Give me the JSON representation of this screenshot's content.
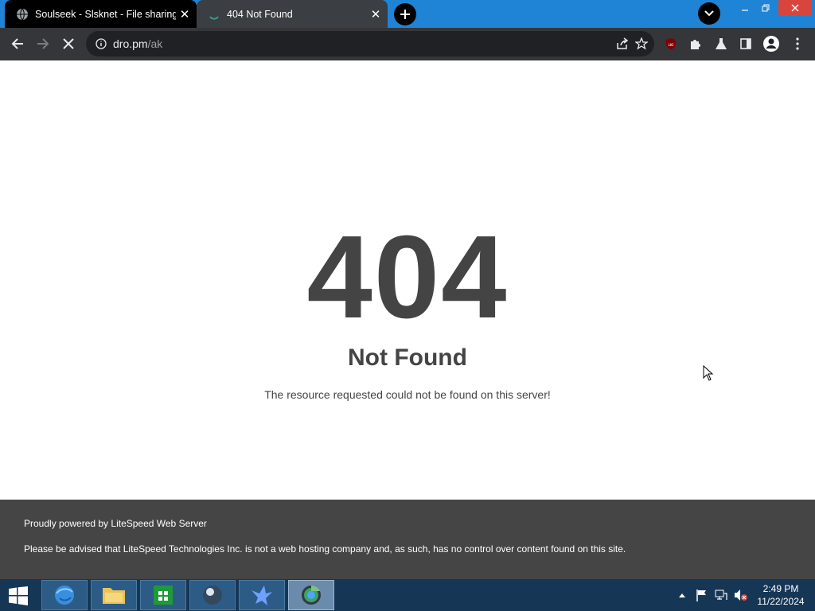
{
  "browser": {
    "tabs": [
      {
        "title": "Soulseek - Slsknet - File sharing"
      },
      {
        "title": "404 Not Found"
      }
    ],
    "address": {
      "host": "dro.pm",
      "path": "/ak"
    },
    "extensions": [
      "ublock-origin-icon",
      "puzzle-extensions-icon",
      "flask-labs-icon",
      "side-panel-icon",
      "profile-avatar-icon"
    ]
  },
  "page": {
    "code": "404",
    "title": "Not Found",
    "description": "The resource requested could not be found on this server!",
    "footer_line1": "Proudly powered by LiteSpeed Web Server",
    "footer_line2": "Please be advised that LiteSpeed Technologies Inc. is not a web hosting company and, as such, has no control over content found on this site."
  },
  "taskbar": {
    "apps": [
      "internet-explorer-icon",
      "file-explorer-icon",
      "windows-store-icon",
      "media-sphere-icon",
      "soulseek-bird-icon",
      "chrome-browser-icon"
    ],
    "time": "2:49 PM",
    "date": "11/22/2024"
  },
  "colors": {
    "tabstrip": "#1f84d6",
    "toolbar": "#353639",
    "error_text": "#444444",
    "footer": "#454545",
    "taskbar": "#163656"
  }
}
